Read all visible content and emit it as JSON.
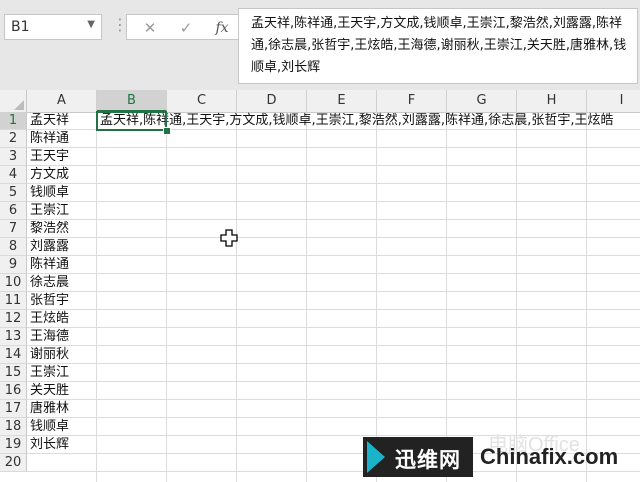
{
  "formula_bar": {
    "name_box": "B1",
    "dots": "⋮",
    "cancel_icon": "✕",
    "enter_icon": "✓",
    "function_icon": "fx",
    "content": "孟天祥,陈祥通,王天宇,方文成,钱顺卓,王崇江,黎浩然,刘露露,陈祥通,徐志晨,张哲宇,王炫皓,王海德,谢丽秋,王崇江,关天胜,唐雅林,钱顺卓,刘长辉"
  },
  "sheet": {
    "columns": [
      "A",
      "B",
      "C",
      "D",
      "E",
      "F",
      "G",
      "H",
      "I"
    ],
    "selected_column": "B",
    "rows": [
      "1",
      "2",
      "3",
      "4",
      "5",
      "6",
      "7",
      "8",
      "9",
      "10",
      "11",
      "12",
      "13",
      "14",
      "15",
      "16",
      "17",
      "18",
      "19",
      "20"
    ],
    "selected_row": "1",
    "column_a": [
      "孟天祥",
      "陈祥通",
      "王天宇",
      "方文成",
      "钱顺卓",
      "王崇江",
      "黎浩然",
      "刘露露",
      "陈祥通",
      "徐志晨",
      "张哲宇",
      "王炫皓",
      "王海德",
      "谢丽秋",
      "王崇江",
      "关天胜",
      "唐雅林",
      "钱顺卓",
      "刘长辉"
    ],
    "b1_value": "孟天祥,陈祥通,王天宇,方文成,钱顺卓,王崇江,黎浩然,刘露露,陈祥通,徐志晨,张哲宇,王炫皓"
  },
  "watermark": {
    "brand_cn": "迅维网",
    "brand_en": "Chinafix.com",
    "faint_text": "电脑Office"
  },
  "colors": {
    "accent": "#217346",
    "header_bg": "#f0f0f0",
    "formula_bg": "#e7e7e7"
  }
}
